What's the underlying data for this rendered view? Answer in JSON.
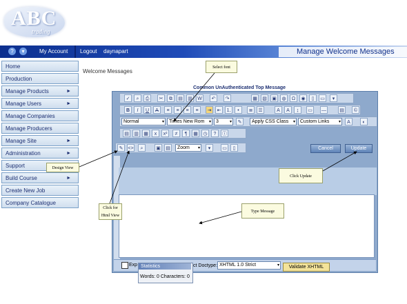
{
  "logo": {
    "main": "ABC",
    "sub": "trading"
  },
  "topbar": {
    "icons": [
      "help-icon",
      "dropdown-icon"
    ],
    "my_account": "My Account",
    "logout": "Logout",
    "username": "daynapart",
    "page_title": "Manage Welcome Messages"
  },
  "sidebar": {
    "items": [
      {
        "label": "Home",
        "arrow": ""
      },
      {
        "label": "Production",
        "arrow": ""
      },
      {
        "label": "Manage Products",
        "arrow": "►"
      },
      {
        "label": "Manage Users",
        "arrow": "►"
      },
      {
        "label": "Manage Companies",
        "arrow": ""
      },
      {
        "label": "Manage Producers",
        "arrow": ""
      },
      {
        "label": "Manage Site",
        "arrow": "►"
      },
      {
        "label": "Administration",
        "arrow": "►"
      },
      {
        "label": "Support",
        "arrow": ""
      },
      {
        "label": "Build Course",
        "arrow": "►"
      },
      {
        "label": "Create New Job",
        "arrow": ""
      },
      {
        "label": "Company Catalogue",
        "arrow": ""
      }
    ]
  },
  "main": {
    "breadcrumb": "Welcome Messages",
    "editor_title": "Common UnAuthenticated Top Message"
  },
  "editor": {
    "format_select": "Normal",
    "font_select": "Times New Rom",
    "size_select": "3",
    "css_select": "Apply CSS Class",
    "links_select": "Custom Links",
    "zoom_select": "Zoom",
    "cancel_label": "Cancel",
    "update_label": "Update",
    "doctype_prefix": "Exp",
    "doctype_label": "ct Doctype:",
    "doctype_value": "XHTML 1.0 Strict",
    "validate_label": "Validate XHTML",
    "stats_title": "Statistics",
    "stats_text": "Words: 0 Characters: 0"
  },
  "callouts": {
    "select_font": "Select font",
    "design_view": "Design View",
    "click_update": "Click Update",
    "click_html": "Click for Html View",
    "type_message": "Type Message"
  },
  "colors": {
    "accent": "#1f4bb8",
    "editor_bg": "#8ea9cc",
    "callout_bg": "#fbfbe0"
  }
}
